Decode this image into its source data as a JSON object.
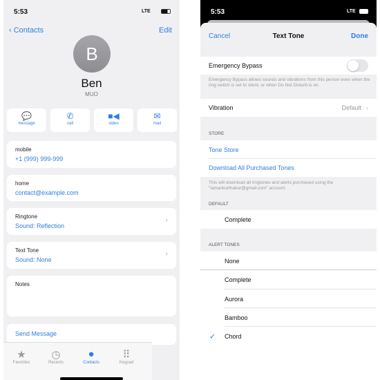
{
  "left": {
    "status": {
      "time": "5:53",
      "network": "LTE"
    },
    "nav": {
      "back": "Contacts",
      "edit": "Edit"
    },
    "contact": {
      "initial": "B",
      "name": "Ben",
      "company": "MUO"
    },
    "actions": [
      {
        "label": "message",
        "icon": "message-icon"
      },
      {
        "label": "call",
        "icon": "phone-icon"
      },
      {
        "label": "video",
        "icon": "video-icon"
      },
      {
        "label": "mail",
        "icon": "mail-icon"
      }
    ],
    "fields": {
      "mobile": {
        "label": "mobile",
        "value": "+1 (999) 999-999"
      },
      "home": {
        "label": "home",
        "value": "contact@example.com"
      },
      "ringtone": {
        "label": "Ringtone",
        "value": "Sound: Reflection"
      },
      "texttone": {
        "label": "Text Tone",
        "value": "Sound: None"
      },
      "notes": {
        "label": "Notes"
      },
      "send": "Send Message"
    },
    "tabs": [
      {
        "label": "Favorites"
      },
      {
        "label": "Recents"
      },
      {
        "label": "Contacts",
        "active": true
      },
      {
        "label": "Keypad"
      }
    ]
  },
  "right": {
    "status": {
      "time": "5:53",
      "network": "LTE"
    },
    "header": {
      "cancel": "Cancel",
      "title": "Text Tone",
      "done": "Done"
    },
    "emergency": {
      "label": "Emergency Bypass",
      "enabled": false,
      "note": "Emergency Bypass allows sounds and vibrations from this person even when the ring switch is set to silent, or when Do Not Disturb is on."
    },
    "vibration": {
      "label": "Vibration",
      "value": "Default"
    },
    "store": {
      "header": "STORE",
      "tone_store": "Tone Store",
      "download": "Download All Purchased Tones",
      "note": "This will download all ringtones and alerts purchased using the \"iamankurthakur@gmail.com\" account."
    },
    "default": {
      "header": "DEFAULT",
      "item": "Complete"
    },
    "alert": {
      "header": "ALERT TONES",
      "items": [
        "None",
        "Complete",
        "Aurora",
        "Bamboo",
        "Chord"
      ],
      "selected": "Chord"
    },
    "colors": {
      "accent": "#2f7fdc"
    }
  }
}
